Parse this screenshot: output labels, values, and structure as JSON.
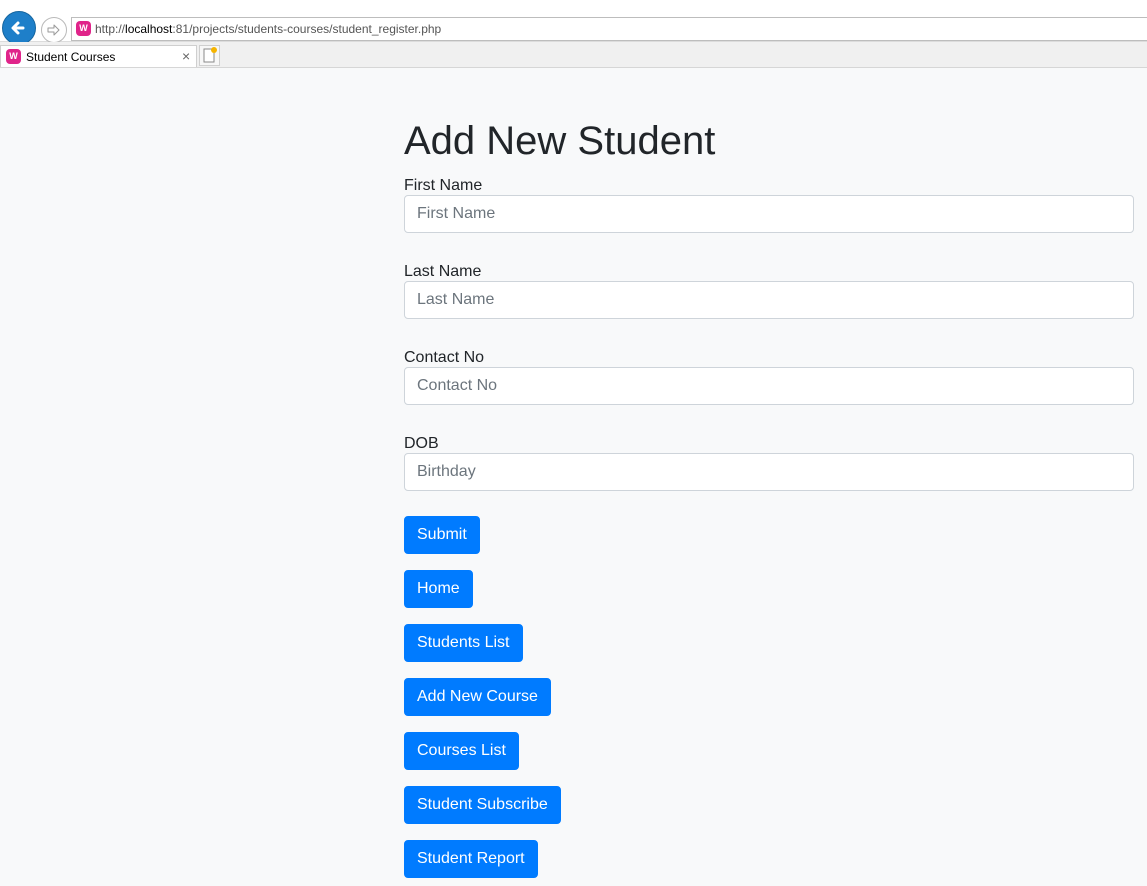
{
  "browser": {
    "url_prefix": "http://",
    "url_host": "localhost",
    "url_path": ":81/projects/students-courses/student_register.php",
    "tab_title": "Student Courses",
    "site_icon_letter": "W",
    "tab_close": "×"
  },
  "form": {
    "title": "Add New Student",
    "fields": [
      {
        "label": "First Name",
        "placeholder": "First Name"
      },
      {
        "label": "Last Name",
        "placeholder": "Last Name"
      },
      {
        "label": "Contact No",
        "placeholder": "Contact No"
      },
      {
        "label": "DOB",
        "placeholder": "Birthday"
      }
    ],
    "submit_label": "Submit"
  },
  "nav_buttons": {
    "home": "Home",
    "students_list": "Students List",
    "add_new_course": "Add New Course",
    "courses_list": "Courses List",
    "student_subscribe": "Student Subscribe",
    "student_report": "Student Report"
  },
  "colors": {
    "primary": "#007bff",
    "page_background": "#f8f9fa",
    "site_icon": "#e0248a"
  }
}
